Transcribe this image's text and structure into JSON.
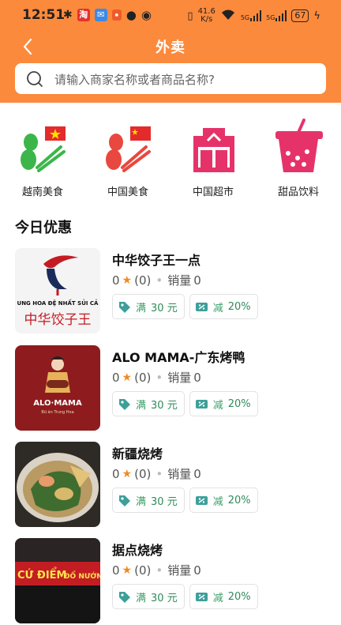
{
  "status_bar": {
    "time": "12:51",
    "speed": "41.6",
    "speed_unit": "K/s",
    "battery": "67",
    "net1": "5G",
    "net2": "5G"
  },
  "header": {
    "title": "外卖",
    "back_icon": "chevron-left-icon",
    "search_placeholder": "请输入商家名称或者商品名称?"
  },
  "categories": [
    {
      "label": "越南美食",
      "icon": "vietnam-food-icon"
    },
    {
      "label": "中国美食",
      "icon": "china-food-icon"
    },
    {
      "label": "中国超市",
      "icon": "supermarket-icon"
    },
    {
      "label": "甜品饮料",
      "icon": "dessert-drink-icon"
    }
  ],
  "section_title": "今日优惠",
  "stores": [
    {
      "name": "中华饺子王一点",
      "rating": "0",
      "reviews": "(0)",
      "sales_label": "销量",
      "sales": "0",
      "tag1": {
        "prefix": "满",
        "amount": "30 元"
      },
      "tag2": {
        "prefix": "减",
        "amount": "20%"
      },
      "thumb_text_top": "UNG HOA ĐỆ NHẤT SỦI CẢ",
      "thumb_text_bottom": "中华饺子王"
    },
    {
      "name": "ALO MAMA-广东烤鸭",
      "rating": "0",
      "reviews": "(0)",
      "sales_label": "销量",
      "sales": "0",
      "tag1": {
        "prefix": "满",
        "amount": "30 元"
      },
      "tag2": {
        "prefix": "减",
        "amount": "20%"
      },
      "thumb_text_top": "ALO·MAMA",
      "thumb_text_bottom": "Bữ ăn Trung Hoa"
    },
    {
      "name": "新疆烧烤",
      "rating": "0",
      "reviews": "(0)",
      "sales_label": "销量",
      "sales": "0",
      "tag1": {
        "prefix": "满",
        "amount": "30 元"
      },
      "tag2": {
        "prefix": "减",
        "amount": "20%"
      },
      "thumb_text_top": "",
      "thumb_text_bottom": ""
    },
    {
      "name": "据点烧烤",
      "rating": "0",
      "reviews": "(0)",
      "sales_label": "销量",
      "sales": "0",
      "tag1": {
        "prefix": "满",
        "amount": "30 元"
      },
      "tag2": {
        "prefix": "减",
        "amount": "20%"
      },
      "thumb_text_top": "CỨ ĐIỂM",
      "thumb_text_bottom": "ĐỔ NƯỚNG"
    }
  ],
  "colors": {
    "accent": "#fb8a3c",
    "tag_text": "#2f8a5b",
    "star": "#f08a24"
  }
}
